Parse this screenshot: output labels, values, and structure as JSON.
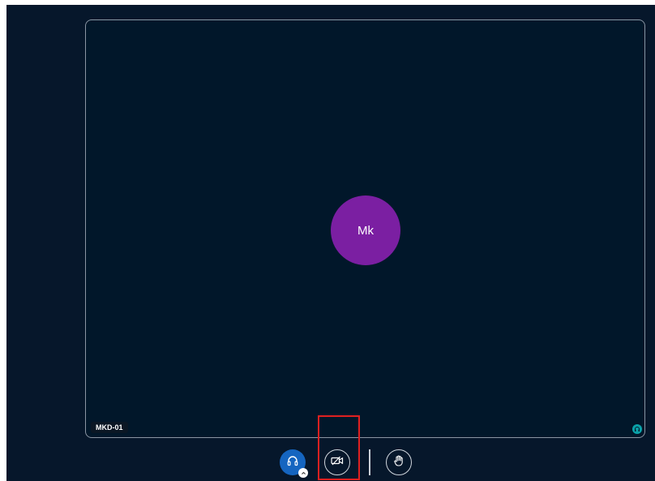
{
  "participant": {
    "initials": "Mk",
    "name": "MKD-01",
    "avatar_color": "#7b1fa2"
  },
  "tile": {
    "audio_status_icon": "headphones-icon"
  },
  "controls": {
    "audio": {
      "icon": "headphones-icon",
      "state": "connected",
      "has_menu": true
    },
    "video": {
      "icon": "camera-off-icon",
      "state": "off"
    },
    "raise_hand": {
      "icon": "hand-icon"
    }
  },
  "colors": {
    "background": "#06172b",
    "tile": "#01172a",
    "audio_button": "#1565c0",
    "audio_indicator": "#0aa1a8",
    "highlight": "#e02020"
  }
}
